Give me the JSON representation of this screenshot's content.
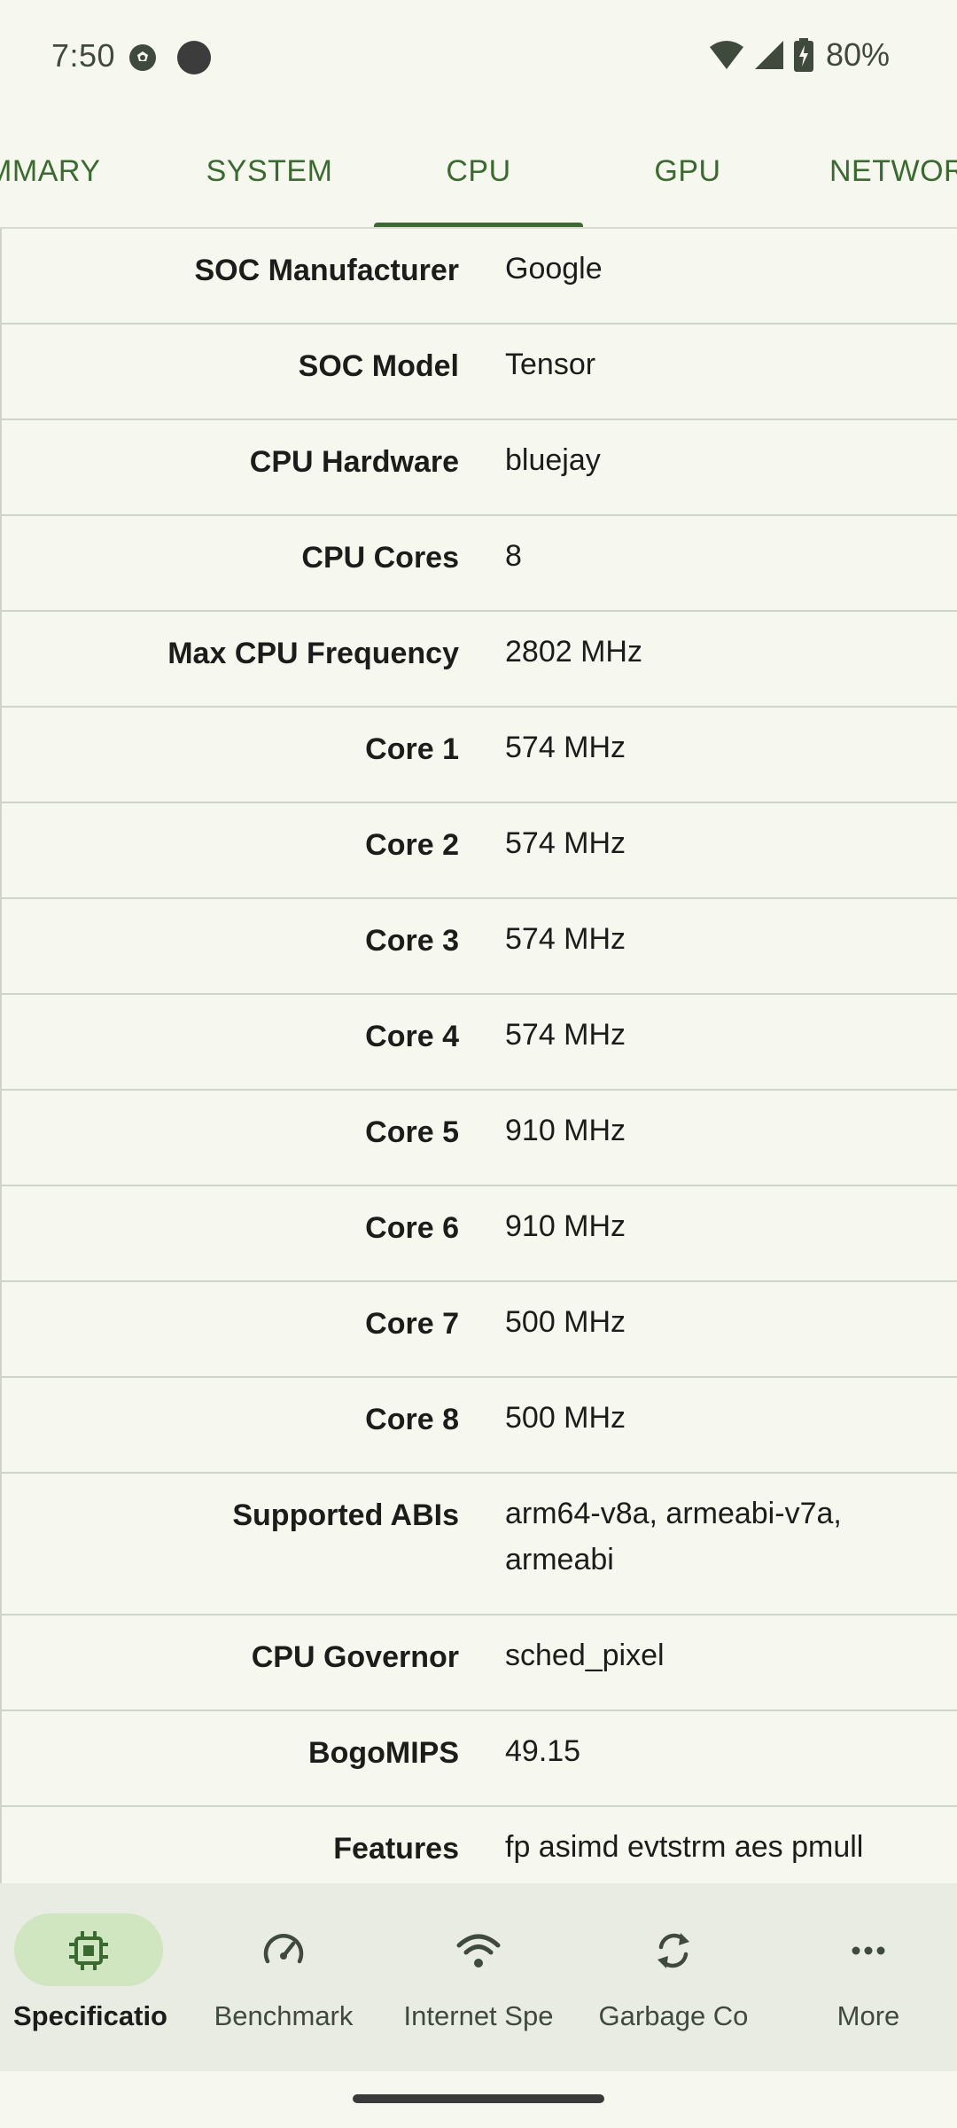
{
  "status_bar": {
    "time": "7:50",
    "battery": "80%",
    "icons": [
      "soccer-ball-icon",
      "notification-dot-icon",
      "wifi-icon",
      "signal-icon",
      "battery-charging-icon"
    ]
  },
  "tabs": {
    "items": [
      {
        "label": "SUMMARY",
        "visible_text": "UMMARY"
      },
      {
        "label": "SYSTEM"
      },
      {
        "label": "CPU",
        "active": true
      },
      {
        "label": "GPU"
      },
      {
        "label": "NETWORK",
        "visible_text": "NETWOR"
      }
    ]
  },
  "specs": [
    {
      "label": "SOC Manufacturer",
      "value": "Google"
    },
    {
      "label": "SOC Model",
      "value": "Tensor"
    },
    {
      "label": "CPU Hardware",
      "value": "bluejay"
    },
    {
      "label": "CPU Cores",
      "value": "8"
    },
    {
      "label": "Max CPU Frequency",
      "value": "2802 MHz"
    },
    {
      "label": "Core 1",
      "value": "574 MHz"
    },
    {
      "label": "Core 2",
      "value": "574 MHz"
    },
    {
      "label": "Core 3",
      "value": "574 MHz"
    },
    {
      "label": "Core 4",
      "value": "574 MHz"
    },
    {
      "label": "Core 5",
      "value": "910 MHz"
    },
    {
      "label": "Core 6",
      "value": "910 MHz"
    },
    {
      "label": "Core 7",
      "value": "500 MHz"
    },
    {
      "label": "Core 8",
      "value": "500 MHz"
    },
    {
      "label": "Supported ABIs",
      "value": "arm64-v8a, armeabi-v7a, armeabi"
    },
    {
      "label": "CPU Governor",
      "value": "sched_pixel"
    },
    {
      "label": "BogoMIPS",
      "value": "49.15"
    },
    {
      "label": "Features",
      "value": "fp asimd evtstrm aes pmull"
    }
  ],
  "bottom_nav": {
    "items": [
      {
        "label": "Specificatio",
        "icon": "chip-icon",
        "active": true
      },
      {
        "label": "Benchmark",
        "icon": "speedometer-icon"
      },
      {
        "label": "Internet Spe",
        "icon": "wifi-icon"
      },
      {
        "label": "Garbage Co",
        "icon": "refresh-icon"
      },
      {
        "label": "More",
        "icon": "more-horizontal-icon"
      }
    ]
  },
  "colors": {
    "background": "#f6f8ef",
    "accent": "#3b6a30",
    "nav_background": "#e9ece2",
    "active_pill": "#cfe6c0",
    "divider": "#cfd4c8"
  }
}
